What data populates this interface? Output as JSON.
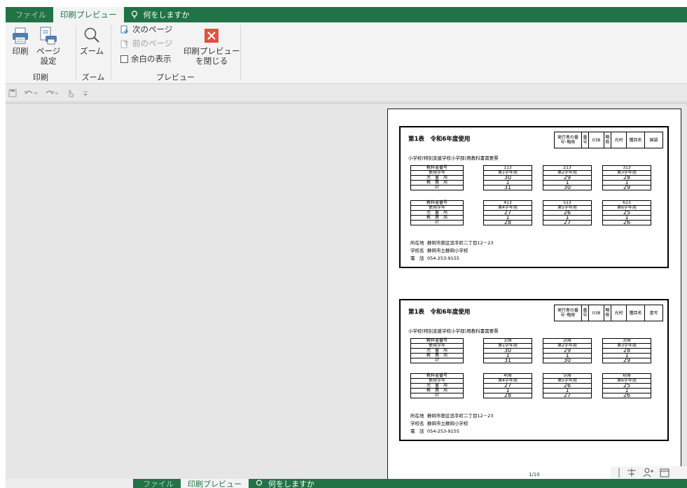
{
  "tabs": {
    "file": "ファイル",
    "print_preview": "印刷プレビュー",
    "tell_me": "何をしますか"
  },
  "ribbon": {
    "print_label": "印刷",
    "page_setup_label_1": "ページ",
    "page_setup_label_2": "設定",
    "zoom_label": "ズーム",
    "next_page": "次のページ",
    "prev_page": "前のページ",
    "show_margins": "余白の表示",
    "close_preview_1": "印刷プレビュー",
    "close_preview_2": "を閉じる",
    "group_print": "印刷",
    "group_zoom": "ズーム",
    "group_preview": "プレビュー"
  },
  "colors": {
    "accent": "#217346",
    "close_red": "#e0533d"
  },
  "documents": [
    {
      "title": "第1表　令和6年度使用",
      "pub_label": "発行者の番号･略称",
      "pub_col1": "番号",
      "pub_num": "038",
      "pub_col2": "略称",
      "pub_abbr": "光村",
      "pub_subject_label": "種目名",
      "pub_subject": "国語",
      "subtitle": "小学校(特別支援学校小学部)用教科書需要票",
      "row_labels": [
        "教科書番号",
        "使用学年",
        "児　童　用",
        "教　員　用",
        "計"
      ],
      "block1": [
        [
          "113",
          "第1学年用",
          "30",
          "1",
          "31"
        ],
        [
          "213",
          "第2学年用",
          "29",
          "1",
          "30"
        ],
        [
          "313",
          "第3学年用",
          "28",
          "1",
          "29"
        ]
      ],
      "block2": [
        [
          "413",
          "第4学年用",
          "27",
          "1",
          "28"
        ],
        [
          "513",
          "第5学年用",
          "26",
          "1",
          "27"
        ],
        [
          "613",
          "第6学年用",
          "25",
          "1",
          "26"
        ]
      ],
      "addr_k1": "所在地",
      "addr_v1": "静岡市葵区追手町二丁目12－23",
      "addr_k2": "学校名",
      "addr_v2": "静岡市立静岡小学校",
      "addr_k3": "電　話",
      "addr_v3": "054-253-9155"
    },
    {
      "title": "第1表　令和6年度使用",
      "pub_label": "発行者の番号･略称",
      "pub_col1": "番号",
      "pub_num": "038",
      "pub_col2": "略称",
      "pub_abbr": "光村",
      "pub_subject_label": "種目名",
      "pub_subject": "書写",
      "subtitle": "小学校(特別支援学校小学部)用教科書需要票",
      "row_labels": [
        "教科書番号",
        "使用学年",
        "児　童　用",
        "教　員　用",
        "計"
      ],
      "block1": [
        [
          "108",
          "第1学年用",
          "30",
          "1",
          "31"
        ],
        [
          "208",
          "第2学年用",
          "29",
          "1",
          "30"
        ],
        [
          "308",
          "第3学年用",
          "28",
          "1",
          "29"
        ]
      ],
      "block2": [
        [
          "408",
          "第4学年用",
          "27",
          "1",
          "28"
        ],
        [
          "508",
          "第5学年用",
          "26",
          "1",
          "27"
        ],
        [
          "608",
          "第6学年用",
          "25",
          "1",
          "26"
        ]
      ],
      "addr_k1": "所在地",
      "addr_v1": "静岡市葵区追手町二丁目12－23",
      "addr_k2": "学校名",
      "addr_v2": "静岡市立静岡小学校",
      "addr_k3": "電　話",
      "addr_v3": "054-253-9155"
    }
  ],
  "page_indicator": "1/10"
}
